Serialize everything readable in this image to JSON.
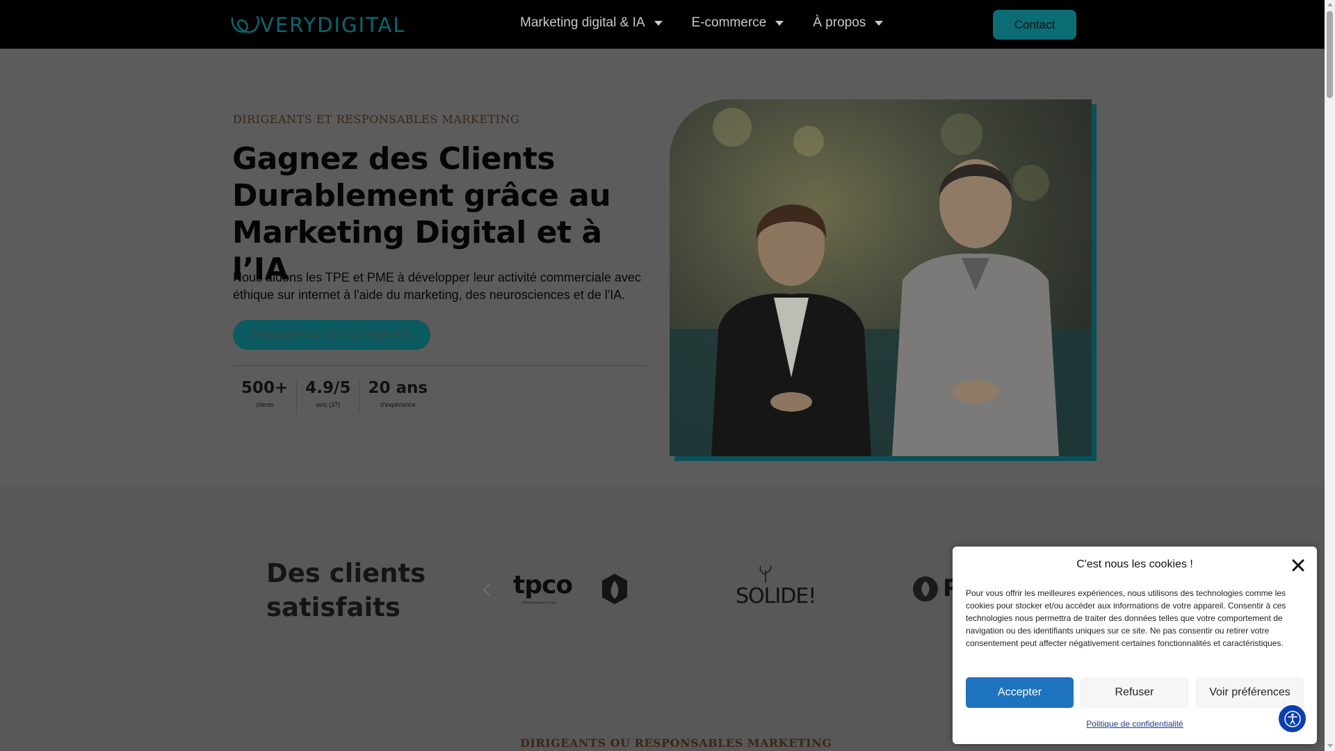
{
  "header": {
    "logo_text": "VERYDIGITAL",
    "nav": [
      {
        "label": "Marketing digital & IA"
      },
      {
        "label": "E-commerce"
      },
      {
        "label": "À propos"
      }
    ],
    "contact_label": "Contact"
  },
  "hero": {
    "eyebrow": "DIRIGEANTS ET RESPONSABLES MARKETING",
    "title": "Gagnez des Clients Durablement grâce au Marketing Digital et à l’IA",
    "subtitle": "Nous aidons les TPE et PME à développer leur activité commerciale avec éthique sur internet à l'aide du marketing, des neurosciences et de l'IA.",
    "cta_label": "Échangeons sur vos objectifs",
    "stats": [
      {
        "value": "500+",
        "label": "clients"
      },
      {
        "value": "4.9/5",
        "label": "avis (37)"
      },
      {
        "value": "20 ans",
        "label": "d'expérience"
      }
    ]
  },
  "clients": {
    "title_line1": "Des clients",
    "title_line2": "satisfaits",
    "logos": [
      {
        "name": "tpco",
        "text": "TPCO",
        "tagline": "PROFESSIONNEL DU GAZ"
      },
      {
        "name": "solide",
        "text": "SOLIDE!"
      },
      {
        "name": "leaf-logo",
        "text": "P"
      }
    ]
  },
  "section2": {
    "eyebrow": "DIRIGEANTS OU RESPONSABLES MARKETING"
  },
  "cookie": {
    "title": "C'est nous les cookies !",
    "text": "Pour vous offrir les meilleures expériences, nous utilisons des technologies comme les cookies pour stocker et/ou accéder aux informations de votre appareil. Consentir à ces technologies nous permettra de traiter des données telles que votre comportement de navigation ou des identifiants uniques sur ce site. Ne pas consentir ou retirer votre consentement peut affecter négativement certaines fonctionnalités et caractéristiques.",
    "accept_label": "Accepter",
    "refuse_label": "Refuser",
    "prefs_label": "Voir préférences",
    "policy_link": "Politique de confidentialité"
  },
  "colors": {
    "brand_teal": "#0b6c74",
    "accept_blue": "#1e73be",
    "overlay_gray": "#5c5c5c"
  },
  "icons": [
    "logo-mark-icon",
    "chevron-down-icon",
    "chevron-left-icon",
    "close-icon",
    "accessibility-icon"
  ]
}
